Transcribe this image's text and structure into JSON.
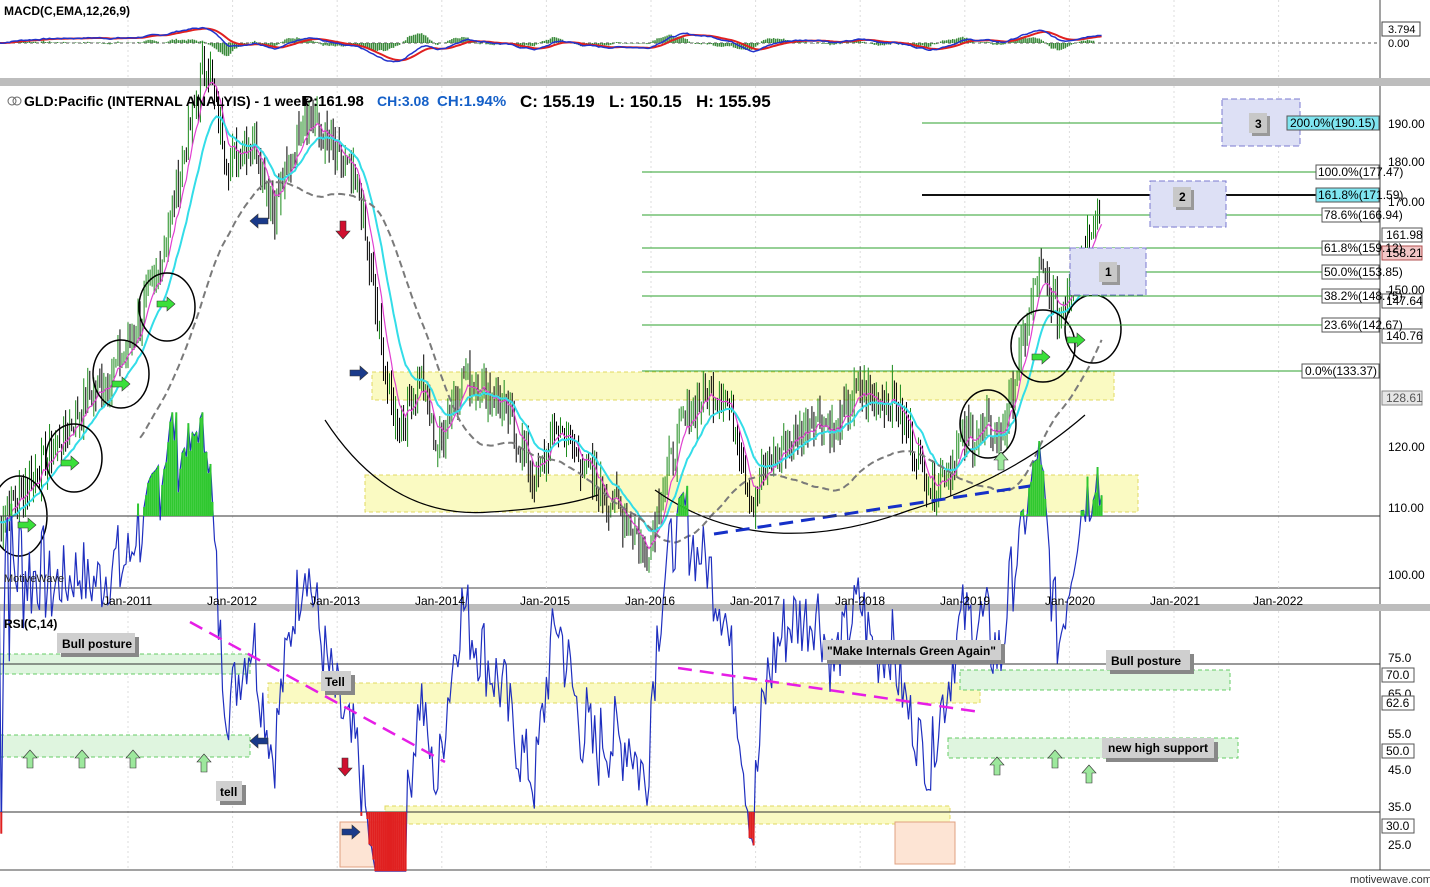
{
  "colors": {
    "up": "#1a8a1a",
    "down": "#000000",
    "ema_pink": "#e040d0",
    "ema_cyan": "#33dde8",
    "sma_gray": "#7a7a7a",
    "macd_blue": "#2233cc",
    "macd_red": "#e02020",
    "hist_green": "#3a8a3a",
    "rsi_blue": "#1f2fbf",
    "fib": "#2ca02c",
    "pink_dash": "#e61ee6",
    "blue_dash": "#1530c8"
  },
  "macd": {
    "label": "MACD(C,EMA,12,26,9)",
    "last": "3.794",
    "zero": "0.00"
  },
  "price": {
    "label": "GLD:Pacific (INTERNAL ANALYIS) - 1 week",
    "p": "P:161.98",
    "ch": "CH:3.08",
    "chp": "CH:1.94%",
    "c": "C: 155.19",
    "l": "L: 150.15",
    "h": "H: 155.95",
    "watermark": "MotiveWave",
    "axis_ticks": [
      "190.00",
      "180.00",
      "170.00",
      "150.00",
      "110.00",
      "100.00",
      "120.00"
    ],
    "badges": [
      {
        "text": "161.98",
        "bg": "#ffffff",
        "border": "#555555"
      },
      {
        "text": "158.21",
        "bg": "#f2c6c6",
        "border": "#b05050"
      },
      {
        "text": "147.64",
        "bg": "#ffffff",
        "border": "#555555"
      },
      {
        "text": "140.76",
        "bg": "#ffffff",
        "border": "#555555"
      },
      {
        "text": "128.61",
        "bg": "#e6e6e6",
        "border": "#888888"
      }
    ],
    "fib_labels": [
      "200.0%(190.15)",
      "100.0%(177.47)",
      "161.8%(171.59)",
      "78.6%(166.94)",
      "61.8%(159.12)",
      "50.0%(153.85)",
      "38.2%(148.75)",
      "23.6%(142.67)",
      "0.0%(133.37)"
    ],
    "wave_labels": [
      "3",
      "2",
      "1"
    ]
  },
  "x_axis": [
    "Jan-2011",
    "Jan-2012",
    "Jan-2013",
    "Jan-2014",
    "Jan-2015",
    "Jan-2016",
    "Jan-2017",
    "Jan-2018",
    "Jan-2019",
    "Jan-2020",
    "Jan-2021",
    "Jan-2022"
  ],
  "rsi": {
    "label": "RSI(C,14)",
    "axis_ticks": [
      "75.0",
      "65.0",
      "55.0",
      "45.0",
      "35.0",
      "25.0"
    ],
    "badges": [
      "70.0",
      "62.6",
      "50.0",
      "30.0"
    ],
    "annotations": [
      "Bull posture",
      "Tell",
      "tell",
      "\"Make Internals Green Again\"",
      "Bull posture",
      "new high support"
    ]
  },
  "footer": "motivewave.com",
  "chart_data": [
    {
      "type": "line",
      "title": "MACD(C,EMA,12,26,9)",
      "x": [
        "Jan-2011",
        "Jan-2012",
        "Jan-2013",
        "Jan-2014",
        "Jan-2015",
        "Jan-2016",
        "Jan-2017",
        "Jan-2018",
        "Jan-2019",
        "Jan-2020"
      ],
      "series": [
        {
          "name": "MACD",
          "values": [
            2.0,
            5.5,
            1.0,
            -4.0,
            -1.5,
            -3.0,
            0.5,
            0.2,
            -1.0,
            3.5
          ]
        },
        {
          "name": "Signal",
          "values": [
            1.5,
            5.0,
            1.5,
            -3.5,
            -1.8,
            -2.5,
            0.8,
            0.3,
            -0.8,
            3.0
          ]
        }
      ],
      "last": 3.794
    },
    {
      "type": "line",
      "title": "GLD:Pacific (INTERNAL ANALYIS) - 1 week",
      "ylim": [
        97,
        197
      ],
      "x": [
        "Jan-2011",
        "Jan-2012",
        "Jan-2013",
        "Jan-2014",
        "Jan-2015",
        "Jan-2016",
        "Jan-2017",
        "Jan-2018",
        "Jan-2019",
        "Jan-2020"
      ],
      "series": [
        {
          "name": "Close",
          "values": [
            134,
            152,
            162,
            119,
            114,
            104,
            110,
            129,
            120,
            146
          ]
        }
      ],
      "fib_levels": [
        190.15,
        177.47,
        171.59,
        166.94,
        159.12,
        153.85,
        148.75,
        142.67,
        133.37
      ],
      "last": {
        "p": 161.98,
        "c": 155.19,
        "l": 150.15,
        "h": 155.95
      }
    },
    {
      "type": "line",
      "title": "RSI(C,14)",
      "ylim": [
        20,
        85
      ],
      "x": [
        "Jan-2011",
        "Jan-2012",
        "Jan-2013",
        "Jan-2014",
        "Jan-2015",
        "Jan-2016",
        "Jan-2017",
        "Jan-2018",
        "Jan-2019",
        "Jan-2020"
      ],
      "series": [
        {
          "name": "RSI",
          "values": [
            65,
            68,
            52,
            42,
            48,
            36,
            55,
            55,
            35,
            70
          ]
        }
      ],
      "levels": [
        70,
        50,
        30
      ],
      "last": 62.6
    }
  ]
}
